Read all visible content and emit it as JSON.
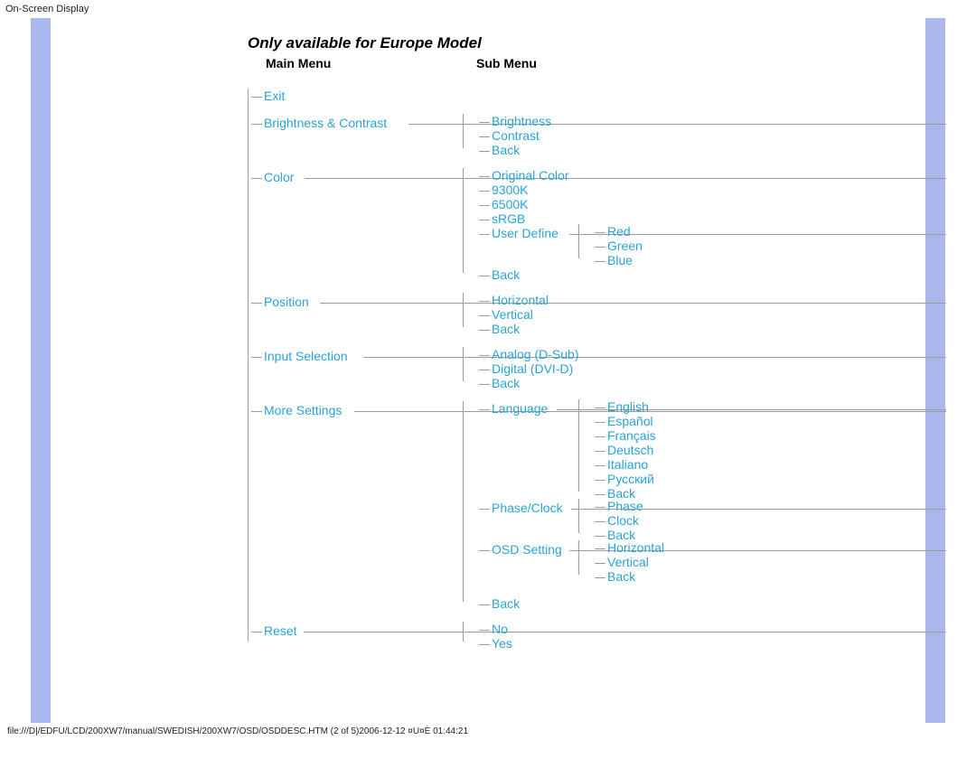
{
  "page_title": "On-Screen Display",
  "note": "Only available for Europe Model",
  "col_main": "Main Menu",
  "col_sub": "Sub Menu",
  "main": {
    "exit": "Exit",
    "bc": "Brightness & Contrast",
    "color": "Color",
    "pos": "Position",
    "inp": "Input Selection",
    "more": "More Settings",
    "reset": "Reset"
  },
  "bc_sub": {
    "bright": "Brightness",
    "contrast": "Contrast",
    "back": "Back"
  },
  "color_sub": {
    "orig": "Original Color",
    "k93": "9300K",
    "k65": "6500K",
    "srgb": "sRGB",
    "user": "User Define",
    "back": "Back"
  },
  "color_user": {
    "r": "Red",
    "g": "Green",
    "b": "Blue"
  },
  "pos_sub": {
    "h": "Horizontal",
    "v": "Vertical",
    "back": "Back"
  },
  "inp_sub": {
    "ana": "Analog (D-Sub)",
    "dig": "Digital (DVI-D)",
    "back": "Back"
  },
  "more_sub": {
    "lang": "Language",
    "phase": "Phase/Clock",
    "osd": "OSD Setting",
    "back": "Back"
  },
  "lang_sub": {
    "en": "English",
    "es": "Español",
    "fr": "Français",
    "de": "Deutsch",
    "it": "Italiano",
    "ru": "Русский",
    "back": "Back"
  },
  "phase_sub": {
    "p": "Phase",
    "c": "Clock",
    "back": "Back"
  },
  "osd_sub": {
    "h": "Horizontal",
    "v": "Vertical",
    "back": "Back"
  },
  "reset_sub": {
    "no": "No",
    "yes": "Yes"
  },
  "footer": "file:///D|/EDFU/LCD/200XW7/manual/SWEDISH/200XW7/OSD/OSDDESC.HTM (2 of 5)2006-12-12 ¤U¤È 01:44:21"
}
